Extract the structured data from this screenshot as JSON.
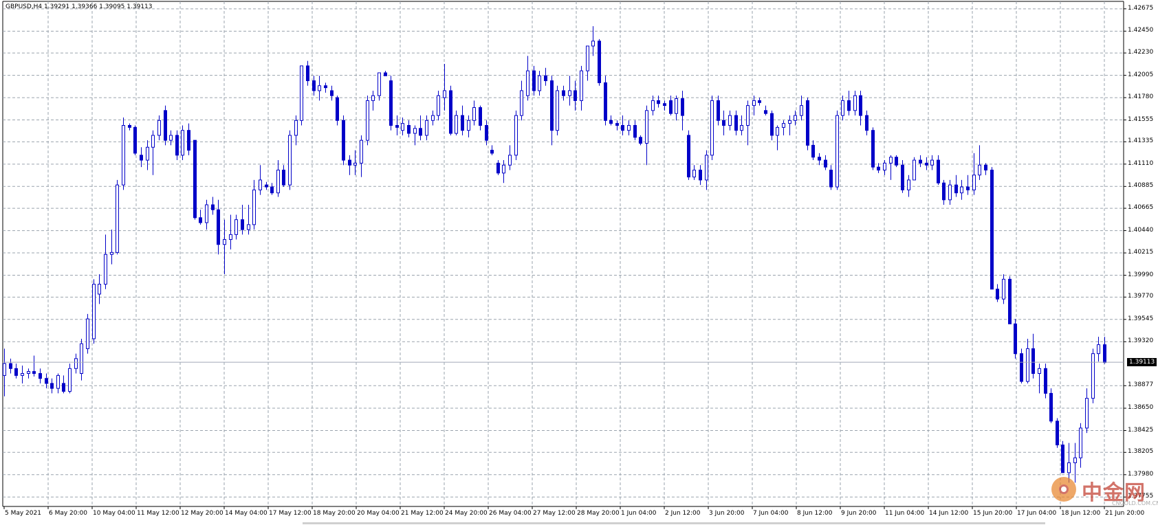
{
  "window": {
    "header_text": "GBPUSD,H4  1.39291 1.39366 1.39095 1.39113",
    "bid_label": "1.39113",
    "bid_value": 1.39113
  },
  "watermark": {
    "brand_text": "中金网",
    "sub_text": "CNGOLD.COM.CN"
  },
  "colors": {
    "candle": "#0000c8",
    "grid": "#9aa3ad",
    "bid_line": "#a0a8b8",
    "axis": "#000000",
    "background": "#ffffff"
  },
  "chart_data": {
    "type": "candlestick",
    "symbol": "GBPUSD",
    "timeframe": "H4",
    "ylim": [
      1.3766,
      1.4275
    ],
    "price_ticks": [
      "1.42675",
      "1.42450",
      "1.42230",
      "1.42005",
      "1.41780",
      "1.41555",
      "1.41335",
      "1.41110",
      "1.40885",
      "1.40665",
      "1.40440",
      "1.40215",
      "1.39990",
      "1.39770",
      "1.39545",
      "1.39320",
      "1.39113",
      "1.38877",
      "1.38650",
      "1.38425",
      "1.38205",
      "1.37980",
      "1.37755"
    ],
    "time_labels": [
      "5 May 2021",
      "6 May 20:00",
      "10 May 04:00",
      "11 May 12:00",
      "12 May 20:00",
      "14 May 04:00",
      "17 May 12:00",
      "18 May 20:00",
      "20 May 04:00",
      "21 May 12:00",
      "24 May 20:00",
      "26 May 04:00",
      "27 May 12:00",
      "28 May 20:00",
      "1 Jun 04:00",
      "2 Jun 12:00",
      "3 Jun 20:00",
      "7 Jun 04:00",
      "8 Jun 12:00",
      "9 Jun 20:00",
      "11 Jun 04:00",
      "14 Jun 12:00",
      "15 Jun 20:00",
      "17 Jun 04:00",
      "18 Jun 12:00",
      "21 Jun 20:00"
    ],
    "candles": [
      [
        1.3898,
        1.3925,
        1.3877,
        1.391
      ],
      [
        1.391,
        1.3915,
        1.39,
        1.3905
      ],
      [
        1.3905,
        1.391,
        1.3895,
        1.3898
      ],
      [
        1.3898,
        1.3908,
        1.389,
        1.39
      ],
      [
        1.39,
        1.3905,
        1.3895,
        1.3902
      ],
      [
        1.3902,
        1.3918,
        1.3897,
        1.39
      ],
      [
        1.39,
        1.3905,
        1.389,
        1.3895
      ],
      [
        1.3895,
        1.39,
        1.3885,
        1.389
      ],
      [
        1.389,
        1.3895,
        1.388,
        1.3885
      ],
      [
        1.3885,
        1.39,
        1.388,
        1.3898
      ],
      [
        1.389,
        1.3898,
        1.388,
        1.3882
      ],
      [
        1.3882,
        1.391,
        1.388,
        1.3905
      ],
      [
        1.3905,
        1.392,
        1.39,
        1.3915
      ],
      [
        1.39,
        1.3935,
        1.3893,
        1.393
      ],
      [
        1.3925,
        1.396,
        1.392,
        1.3955
      ],
      [
        1.3935,
        1.3995,
        1.393,
        1.399
      ],
      [
        1.398,
        1.4,
        1.397,
        1.399
      ],
      [
        1.399,
        1.404,
        1.3985,
        1.402
      ],
      [
        1.402,
        1.4045,
        1.401,
        1.4022
      ],
      [
        1.4022,
        1.4095,
        1.402,
        1.409
      ],
      [
        1.409,
        1.4158,
        1.4085,
        1.415
      ],
      [
        1.415,
        1.4152,
        1.4145,
        1.4148
      ],
      [
        1.4148,
        1.415,
        1.412,
        1.4122
      ],
      [
        1.412,
        1.4128,
        1.4108,
        1.4115
      ],
      [
        1.4115,
        1.4135,
        1.4105,
        1.4128
      ],
      [
        1.4128,
        1.4145,
        1.41,
        1.414
      ],
      [
        1.414,
        1.416,
        1.4135,
        1.4155
      ],
      [
        1.4165,
        1.417,
        1.413,
        1.4135
      ],
      [
        1.4135,
        1.4145,
        1.413,
        1.414
      ],
      [
        1.414,
        1.4145,
        1.4115,
        1.412
      ],
      [
        1.412,
        1.415,
        1.4115,
        1.4145
      ],
      [
        1.4145,
        1.4152,
        1.412,
        1.4125
      ],
      [
        1.4135,
        1.4135,
        1.4055,
        1.4057
      ],
      [
        1.4057,
        1.4065,
        1.405,
        1.4052
      ],
      [
        1.4052,
        1.4075,
        1.4045,
        1.407
      ],
      [
        1.407,
        1.4078,
        1.406,
        1.4065
      ],
      [
        1.4065,
        1.4075,
        1.402,
        1.403
      ],
      [
        1.403,
        1.4055,
        1.4,
        1.4035
      ],
      [
        1.4035,
        1.406,
        1.4025,
        1.404
      ],
      [
        1.404,
        1.406,
        1.4035,
        1.4055
      ],
      [
        1.4055,
        1.407,
        1.404,
        1.4045
      ],
      [
        1.4045,
        1.407,
        1.404,
        1.405
      ],
      [
        1.405,
        1.4095,
        1.4045,
        1.4085
      ],
      [
        1.4085,
        1.411,
        1.408,
        1.4095
      ],
      [
        1.409,
        1.4093,
        1.4085,
        1.4088
      ],
      [
        1.4088,
        1.4092,
        1.408,
        1.4082
      ],
      [
        1.4082,
        1.4115,
        1.4078,
        1.4105
      ],
      [
        1.4105,
        1.411,
        1.4088,
        1.409
      ],
      [
        1.409,
        1.4145,
        1.4085,
        1.414
      ],
      [
        1.414,
        1.416,
        1.413,
        1.4155
      ],
      [
        1.4155,
        1.42,
        1.415,
        1.421
      ],
      [
        1.421,
        1.4215,
        1.419,
        1.4195
      ],
      [
        1.4195,
        1.42,
        1.418,
        1.4185
      ],
      [
        1.4185,
        1.42,
        1.4175,
        1.419
      ],
      [
        1.419,
        1.4193,
        1.4183,
        1.4188
      ],
      [
        1.4185,
        1.419,
        1.4175,
        1.418
      ],
      [
        1.4178,
        1.418,
        1.415,
        1.4155
      ],
      [
        1.4155,
        1.416,
        1.411,
        1.4115
      ],
      [
        1.4115,
        1.412,
        1.41,
        1.411
      ],
      [
        1.411,
        1.4125,
        1.41,
        1.4112
      ],
      [
        1.4112,
        1.414,
        1.4098,
        1.4135
      ],
      [
        1.4135,
        1.418,
        1.413,
        1.4175
      ],
      [
        1.4175,
        1.4185,
        1.4165,
        1.418
      ],
      [
        1.418,
        1.42,
        1.4175,
        1.4203
      ],
      [
        1.4203,
        1.4205,
        1.42,
        1.42
      ],
      [
        1.4195,
        1.42,
        1.4145,
        1.415
      ],
      [
        1.415,
        1.416,
        1.414,
        1.4148
      ],
      [
        1.4145,
        1.4158,
        1.414,
        1.4152
      ],
      [
        1.415,
        1.4155,
        1.4138,
        1.4142
      ],
      [
        1.4142,
        1.415,
        1.413,
        1.4147
      ],
      [
        1.4147,
        1.416,
        1.4135,
        1.414
      ],
      [
        1.414,
        1.416,
        1.4135,
        1.4155
      ],
      [
        1.4155,
        1.4165,
        1.415,
        1.416
      ],
      [
        1.416,
        1.4185,
        1.4155,
        1.418
      ],
      [
        1.4178,
        1.4212,
        1.4165,
        1.4185
      ],
      [
        1.4185,
        1.419,
        1.414,
        1.4142
      ],
      [
        1.4142,
        1.4165,
        1.414,
        1.416
      ],
      [
        1.416,
        1.417,
        1.414,
        1.4145
      ],
      [
        1.4145,
        1.416,
        1.4138,
        1.4155
      ],
      [
        1.4155,
        1.4175,
        1.415,
        1.4168
      ],
      [
        1.4168,
        1.417,
        1.4145,
        1.415
      ],
      [
        1.415,
        1.4155,
        1.413,
        1.4135
      ],
      [
        1.4125,
        1.413,
        1.412,
        1.4122
      ],
      [
        1.4112,
        1.4115,
        1.41,
        1.4102
      ],
      [
        1.4102,
        1.4115,
        1.4092,
        1.411
      ],
      [
        1.411,
        1.413,
        1.4105,
        1.412
      ],
      [
        1.412,
        1.4165,
        1.4115,
        1.416
      ],
      [
        1.416,
        1.4195,
        1.4155,
        1.4185
      ],
      [
        1.418,
        1.422,
        1.4175,
        1.4205
      ],
      [
        1.4205,
        1.421,
        1.418,
        1.4185
      ],
      [
        1.4185,
        1.4205,
        1.418,
        1.42
      ],
      [
        1.42,
        1.4208,
        1.419,
        1.4195
      ],
      [
        1.4195,
        1.42,
        1.413,
        1.4145
      ],
      [
        1.4145,
        1.419,
        1.414,
        1.4185
      ],
      [
        1.4185,
        1.419,
        1.4175,
        1.418
      ],
      [
        1.418,
        1.42,
        1.417,
        1.4185
      ],
      [
        1.4185,
        1.4195,
        1.4165,
        1.4175
      ],
      [
        1.4175,
        1.421,
        1.4165,
        1.4205
      ],
      [
        1.4205,
        1.4225,
        1.4195,
        1.423
      ],
      [
        1.423,
        1.425,
        1.422,
        1.4235
      ],
      [
        1.4235,
        1.4237,
        1.419,
        1.4193
      ],
      [
        1.4193,
        1.42,
        1.415,
        1.4155
      ],
      [
        1.4155,
        1.416,
        1.415,
        1.4152
      ],
      [
        1.4152,
        1.4155,
        1.4145,
        1.415
      ],
      [
        1.415,
        1.416,
        1.414,
        1.4145
      ],
      [
        1.4145,
        1.4155,
        1.414,
        1.415
      ],
      [
        1.415,
        1.4155,
        1.4135,
        1.4138
      ],
      [
        1.4138,
        1.414,
        1.413,
        1.4132
      ],
      [
        1.4132,
        1.417,
        1.411,
        1.4165
      ],
      [
        1.4165,
        1.418,
        1.416,
        1.4175
      ],
      [
        1.4175,
        1.418,
        1.4168,
        1.4172
      ],
      [
        1.4172,
        1.4175,
        1.4165,
        1.417
      ],
      [
        1.4175,
        1.418,
        1.416,
        1.4162
      ],
      [
        1.4162,
        1.418,
        1.4155,
        1.4177
      ],
      [
        1.4177,
        1.4185,
        1.4145,
        1.416
      ],
      [
        1.414,
        1.4145,
        1.4095,
        1.4098
      ],
      [
        1.4098,
        1.411,
        1.4095,
        1.4105
      ],
      [
        1.4105,
        1.411,
        1.409,
        1.4095
      ],
      [
        1.4095,
        1.4125,
        1.4085,
        1.412
      ],
      [
        1.412,
        1.418,
        1.4115,
        1.4175
      ],
      [
        1.4175,
        1.418,
        1.415,
        1.4155
      ],
      [
        1.4155,
        1.4165,
        1.414,
        1.415
      ],
      [
        1.415,
        1.4165,
        1.4145,
        1.416
      ],
      [
        1.416,
        1.4165,
        1.414,
        1.4145
      ],
      [
        1.4145,
        1.416,
        1.414,
        1.415
      ],
      [
        1.415,
        1.4175,
        1.413,
        1.417
      ],
      [
        1.417,
        1.418,
        1.416,
        1.4175
      ],
      [
        1.4175,
        1.4178,
        1.417,
        1.4173
      ],
      [
        1.4165,
        1.417,
        1.416,
        1.4162
      ],
      [
        1.4162,
        1.4165,
        1.4135,
        1.414
      ],
      [
        1.414,
        1.415,
        1.4125,
        1.4148
      ],
      [
        1.4148,
        1.4155,
        1.414,
        1.4152
      ],
      [
        1.4152,
        1.416,
        1.414,
        1.4155
      ],
      [
        1.4155,
        1.4165,
        1.415,
        1.416
      ],
      [
        1.416,
        1.418,
        1.4155,
        1.417
      ],
      [
        1.4175,
        1.4178,
        1.4125,
        1.413
      ],
      [
        1.413,
        1.4135,
        1.4115,
        1.4118
      ],
      [
        1.4118,
        1.4122,
        1.411,
        1.4115
      ],
      [
        1.4115,
        1.412,
        1.4105,
        1.4108
      ],
      [
        1.4105,
        1.411,
        1.4085,
        1.4088
      ],
      [
        1.4088,
        1.4165,
        1.4085,
        1.416
      ],
      [
        1.416,
        1.418,
        1.4155,
        1.4175
      ],
      [
        1.4175,
        1.4185,
        1.416,
        1.4165
      ],
      [
        1.4165,
        1.4185,
        1.416,
        1.418
      ],
      [
        1.418,
        1.4185,
        1.415,
        1.416
      ],
      [
        1.416,
        1.4165,
        1.414,
        1.4145
      ],
      [
        1.4145,
        1.4148,
        1.4105,
        1.4108
      ],
      [
        1.4108,
        1.4112,
        1.4102,
        1.4105
      ],
      [
        1.4105,
        1.4115,
        1.41,
        1.4112
      ],
      [
        1.4112,
        1.412,
        1.4095,
        1.4118
      ],
      [
        1.4118,
        1.412,
        1.4108,
        1.411
      ],
      [
        1.411,
        1.4115,
        1.4082,
        1.4085
      ],
      [
        1.4085,
        1.41,
        1.4078,
        1.4095
      ],
      [
        1.4095,
        1.4118,
        1.4095,
        1.4115
      ],
      [
        1.4115,
        1.412,
        1.4108,
        1.4112
      ],
      [
        1.4112,
        1.4118,
        1.4105,
        1.411
      ],
      [
        1.411,
        1.412,
        1.4105,
        1.4115
      ],
      [
        1.4115,
        1.412,
        1.409,
        1.4092
      ],
      [
        1.4092,
        1.4095,
        1.407,
        1.4075
      ],
      [
        1.4075,
        1.4095,
        1.407,
        1.409
      ],
      [
        1.409,
        1.41,
        1.4078,
        1.4082
      ],
      [
        1.4082,
        1.4095,
        1.4075,
        1.4088
      ],
      [
        1.4088,
        1.41,
        1.408,
        1.4085
      ],
      [
        1.4085,
        1.4122,
        1.408,
        1.41
      ],
      [
        1.41,
        1.413,
        1.4095,
        1.411
      ],
      [
        1.411,
        1.4112,
        1.41,
        1.4105
      ],
      [
        1.4105,
        1.4108,
        1.399,
        1.3985
      ],
      [
        1.3985,
        1.399,
        1.3972,
        1.3975
      ],
      [
        1.3975,
        1.4,
        1.397,
        1.3995
      ],
      [
        1.3995,
        1.3998,
        1.395,
        1.395
      ],
      [
        1.395,
        1.3955,
        1.3915,
        1.392
      ],
      [
        1.392,
        1.3925,
        1.389,
        1.3892
      ],
      [
        1.3892,
        1.3935,
        1.389,
        1.3925
      ],
      [
        1.3925,
        1.394,
        1.3895,
        1.39
      ],
      [
        1.39,
        1.391,
        1.388,
        1.3905
      ],
      [
        1.3905,
        1.391,
        1.3875,
        1.388
      ],
      [
        1.388,
        1.3885,
        1.385,
        1.3852
      ],
      [
        1.3852,
        1.3855,
        1.3825,
        1.3828
      ],
      [
        1.3828,
        1.3832,
        1.38,
        1.38
      ],
      [
        1.38,
        1.383,
        1.379,
        1.381
      ],
      [
        1.381,
        1.383,
        1.379,
        1.3815
      ],
      [
        1.3815,
        1.385,
        1.3805,
        1.3845
      ],
      [
        1.3845,
        1.3885,
        1.384,
        1.3875
      ],
      [
        1.3875,
        1.3925,
        1.387,
        1.392
      ],
      [
        1.392,
        1.3937,
        1.3912,
        1.3929
      ],
      [
        1.3929,
        1.3937,
        1.391,
        1.3911
      ]
    ]
  }
}
